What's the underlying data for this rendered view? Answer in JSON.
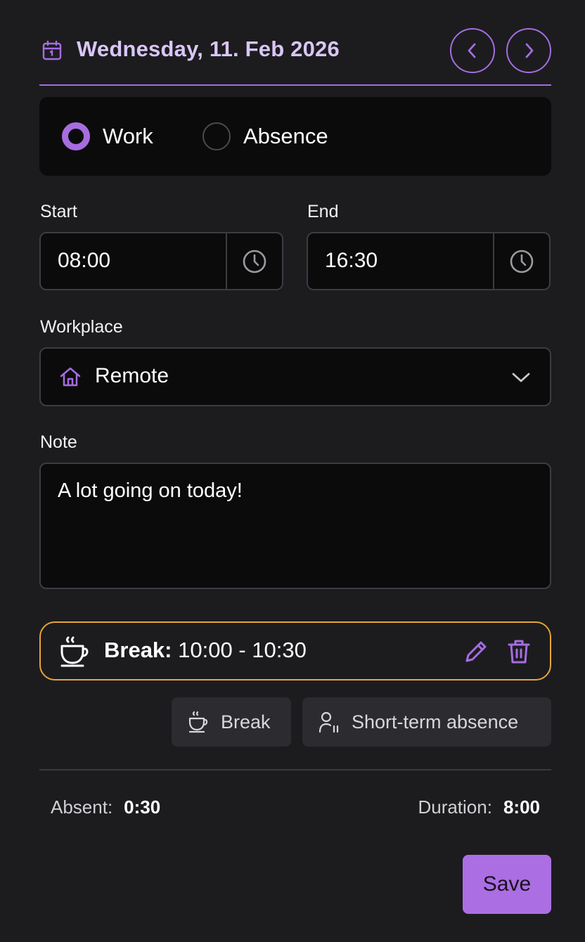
{
  "header": {
    "date": "Wednesday, 11. Feb 2026",
    "prev_icon": "chevron-left-icon",
    "next_icon": "chevron-right-icon"
  },
  "entry_type": {
    "options": [
      {
        "label": "Work",
        "selected": true
      },
      {
        "label": "Absence",
        "selected": false
      }
    ]
  },
  "time": {
    "start_label": "Start",
    "start_value": "08:00",
    "end_label": "End",
    "end_value": "16:30"
  },
  "workplace": {
    "label": "Workplace",
    "value": "Remote",
    "icon": "home-icon"
  },
  "note": {
    "label": "Note",
    "value": "A lot going on today!"
  },
  "break_entry": {
    "title": "Break:",
    "time": "10:00 - 10:30",
    "icon": "coffee-icon"
  },
  "actions": {
    "break_label": "Break",
    "short_absence_label": "Short-term absence"
  },
  "summary": {
    "absent_label": "Absent:",
    "absent_value": "0:30",
    "duration_label": "Duration:",
    "duration_value": "8:00"
  },
  "save_label": "Save",
  "colors": {
    "accent": "#a66de0",
    "break_border": "#e5a53a",
    "background": "#1c1c1f",
    "input_bg": "#0b0b0c"
  }
}
